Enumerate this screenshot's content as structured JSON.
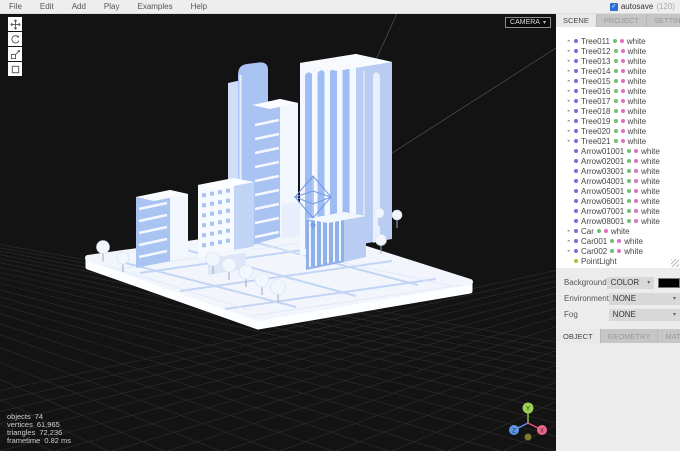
{
  "menubar": {
    "items": [
      "File",
      "Edit",
      "Add",
      "Play",
      "Examples",
      "Help"
    ],
    "autosave_label": "autosave",
    "autosave_extra": "(120)"
  },
  "icons": {
    "check": "✓",
    "caret_down": "▾",
    "expander": "▸"
  },
  "viewport": {
    "camera_label": "CAMERA",
    "toolbar": [
      {
        "name": "translate-tool-button",
        "icon": "translate-icon"
      },
      {
        "name": "rotate-tool-button",
        "icon": "rotate-icon"
      },
      {
        "name": "scale-tool-button",
        "icon": "scale-icon"
      },
      {
        "name": "local-space-toggle",
        "icon": "local-space-icon"
      }
    ],
    "stats": [
      {
        "label": "objects",
        "value": "74"
      },
      {
        "label": "vertices",
        "value": "61,965"
      },
      {
        "label": "triangles",
        "value": "72,236"
      },
      {
        "label": "frametime",
        "value": "0.82 ms"
      }
    ],
    "axis_labels": {
      "x": "X",
      "y": "Y",
      "z": "Z"
    }
  },
  "sidebar": {
    "tabs": [
      {
        "label": "SCENE",
        "active": true
      },
      {
        "label": "PROJECT",
        "active": false
      },
      {
        "label": "SETTINGS",
        "active": false
      }
    ],
    "outliner": {
      "items": [
        {
          "name": "Tree011",
          "type": "Mesh",
          "material": "white",
          "exp": true
        },
        {
          "name": "Tree012",
          "type": "Mesh",
          "material": "white",
          "exp": true
        },
        {
          "name": "Tree013",
          "type": "Mesh",
          "material": "white",
          "exp": true
        },
        {
          "name": "Tree014",
          "type": "Mesh",
          "material": "white",
          "exp": true
        },
        {
          "name": "Tree015",
          "type": "Mesh",
          "material": "white",
          "exp": true
        },
        {
          "name": "Tree016",
          "type": "Mesh",
          "material": "white",
          "exp": true
        },
        {
          "name": "Tree017",
          "type": "Mesh",
          "material": "white",
          "exp": true
        },
        {
          "name": "Tree018",
          "type": "Mesh",
          "material": "white",
          "exp": true
        },
        {
          "name": "Tree019",
          "type": "Mesh",
          "material": "white",
          "exp": true
        },
        {
          "name": "Tree020",
          "type": "Mesh",
          "material": "white",
          "exp": true
        },
        {
          "name": "Tree021",
          "type": "Mesh",
          "material": "white",
          "exp": true
        },
        {
          "name": "Arrow01001",
          "type": "Mesh",
          "material": "white",
          "exp": false
        },
        {
          "name": "Arrow02001",
          "type": "Mesh",
          "material": "white",
          "exp": false
        },
        {
          "name": "Arrow03001",
          "type": "Mesh",
          "material": "white",
          "exp": false
        },
        {
          "name": "Arrow04001",
          "type": "Mesh",
          "material": "white",
          "exp": false
        },
        {
          "name": "Arrow05001",
          "type": "Mesh",
          "material": "white",
          "exp": false
        },
        {
          "name": "Arrow06001",
          "type": "Mesh",
          "material": "white",
          "exp": false
        },
        {
          "name": "Arrow07001",
          "type": "Mesh",
          "material": "white",
          "exp": false
        },
        {
          "name": "Arrow08001",
          "type": "Mesh",
          "material": "white",
          "exp": false
        },
        {
          "name": "Car",
          "type": "Mesh",
          "material": "white",
          "exp": true
        },
        {
          "name": "Car001",
          "type": "Mesh",
          "material": "white",
          "exp": true
        },
        {
          "name": "Car002",
          "type": "Mesh",
          "material": "white",
          "exp": true
        },
        {
          "name": "PointLight",
          "type": "Light",
          "material": null,
          "exp": false
        }
      ]
    },
    "properties": [
      {
        "label": "Background",
        "value": "COLOR",
        "swatch": "#000000"
      },
      {
        "label": "Environment",
        "value": "NONE",
        "swatch": null
      },
      {
        "label": "Fog",
        "value": "NONE",
        "swatch": null
      }
    ],
    "tabs2": [
      {
        "label": "OBJECT",
        "active": true
      },
      {
        "label": "GEOMETRY",
        "active": false
      },
      {
        "label": "MATERIAL",
        "active": false
      }
    ]
  },
  "colors": {
    "viewport_bg": "#131313",
    "grid_line": "#2b2b2b",
    "building_blue": "#a9c4f3",
    "building_dark_blue": "#8fb0ea",
    "platform": "#f2f6fc",
    "street_blue": "#c3d5f4",
    "mesh_dot": "#7070e0",
    "geometry_dot": "#70c070",
    "material_dot": "#e070c0",
    "light_dot": "#b8b832",
    "autosave_checkbox": "#2a6fd6",
    "axis_x": "#e4537a",
    "axis_y": "#9ccf52",
    "axis_z": "#5e97e8"
  }
}
